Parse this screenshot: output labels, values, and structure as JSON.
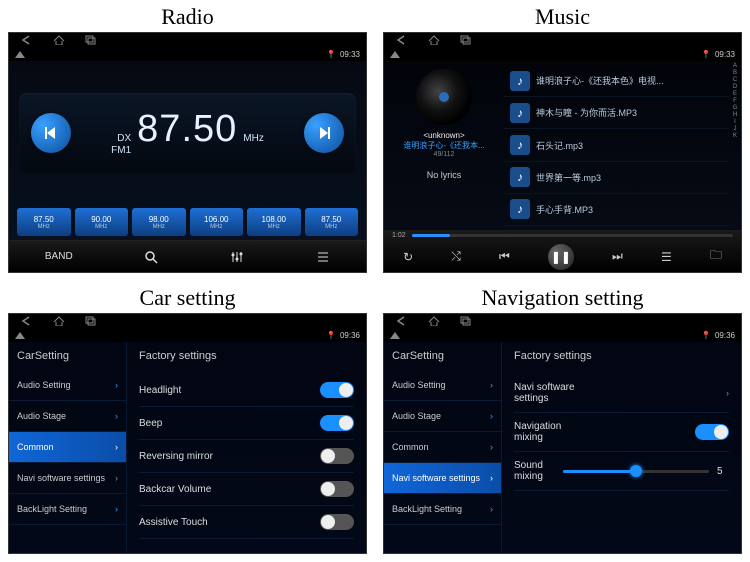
{
  "captions": {
    "radio": "Radio",
    "music": "Music",
    "car": "Car setting",
    "nav": "Navigation setting"
  },
  "status": {
    "time_radio": "09:33",
    "time_music": "09:33",
    "time_car": "09:36",
    "time_nav": "09:36"
  },
  "radio": {
    "dx": "DX",
    "band_label": "FM1",
    "frequency": "87.50",
    "unit": "MHz",
    "presets": [
      {
        "freq": "87.50",
        "unit": "MHz"
      },
      {
        "freq": "90.00",
        "unit": "MHz"
      },
      {
        "freq": "98.00",
        "unit": "MHz"
      },
      {
        "freq": "106.00",
        "unit": "MHz"
      },
      {
        "freq": "108.00",
        "unit": "MHz"
      },
      {
        "freq": "87.50",
        "unit": "MHz"
      }
    ],
    "footer": {
      "band": "BAND"
    }
  },
  "music": {
    "unknown": "<unknown>",
    "title": "谁明浪子心-《还我本...",
    "index": "49/112",
    "nolyrics": "No lyrics",
    "tracks": [
      "谁明浪子心-《还我本色》电视...",
      "神木与瞳 - 为你而活.MP3",
      "石头记.mp3",
      "世界第一等.mp3",
      "手心手背.MP3"
    ],
    "alpha": [
      "A",
      "B",
      "C",
      "D",
      "E",
      "F",
      "G",
      "H",
      "I",
      "J",
      "K"
    ],
    "time": "1:02"
  },
  "carSetting": {
    "sideTitle": "CarSetting",
    "side": [
      "Audio Setting",
      "Audio Stage",
      "Common",
      "Navi software settings",
      "BackLight Setting"
    ],
    "mainTitle": "Factory settings",
    "rows": [
      {
        "label": "Headlight",
        "on": true
      },
      {
        "label": "Beep",
        "on": true
      },
      {
        "label": "Reversing mirror",
        "on": false
      },
      {
        "label": "Backcar Volume",
        "on": false
      },
      {
        "label": "Assistive Touch",
        "on": false
      }
    ]
  },
  "navSetting": {
    "sideTitle": "CarSetting",
    "side": [
      "Audio Setting",
      "Audio Stage",
      "Common",
      "Navi software settings",
      "BackLight Setting"
    ],
    "mainTitle": "Factory settings",
    "rows": [
      {
        "label": "Navi software\nsettings",
        "type": "link"
      },
      {
        "label": "Navigation\nmixing",
        "type": "toggle",
        "on": true
      },
      {
        "label": "Sound\nmixing",
        "type": "slider",
        "value": 5,
        "max": 10
      }
    ]
  }
}
